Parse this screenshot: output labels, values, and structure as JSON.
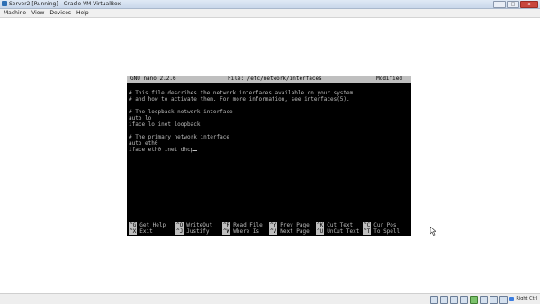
{
  "window": {
    "title": "Server2 [Running] - Oracle VM VirtualBox",
    "min": "–",
    "max": "□",
    "close": "x"
  },
  "menu": {
    "items": [
      "Machine",
      "View",
      "Devices",
      "Help"
    ]
  },
  "nano": {
    "version": "GNU nano 2.2.6",
    "file": "File: /etc/network/interfaces",
    "status": "Modified",
    "lines": [
      "# This file describes the network interfaces available on your system",
      "# and how to activate them. For more information, see interfaces(5).",
      "",
      "# The loopback network interface",
      "auto lo",
      "iface lo inet loopback",
      "",
      "# The primary network interface",
      "auto eth0",
      "iface eth0 inet dhcp"
    ],
    "shortcuts_row1": [
      {
        "key": "^G",
        "label": "Get Help"
      },
      {
        "key": "^O",
        "label": "WriteOut"
      },
      {
        "key": "^R",
        "label": "Read File"
      },
      {
        "key": "^Y",
        "label": "Prev Page"
      },
      {
        "key": "^K",
        "label": "Cut Text"
      },
      {
        "key": "^C",
        "label": "Cur Pos"
      }
    ],
    "shortcuts_row2": [
      {
        "key": "^X",
        "label": "Exit"
      },
      {
        "key": "^J",
        "label": "Justify"
      },
      {
        "key": "^W",
        "label": "Where Is"
      },
      {
        "key": "^V",
        "label": "Next Page"
      },
      {
        "key": "^U",
        "label": "UnCut Text"
      },
      {
        "key": "^T",
        "label": "To Spell"
      }
    ]
  },
  "statusbar": {
    "host_key": "Right Ctrl",
    "icons": [
      "hard-disk-icon",
      "optical-drive-icon",
      "usb-icon",
      "shared-folder-icon",
      "network-icon",
      "display-icon",
      "video-capture-icon",
      "mouse-integration-icon"
    ]
  }
}
